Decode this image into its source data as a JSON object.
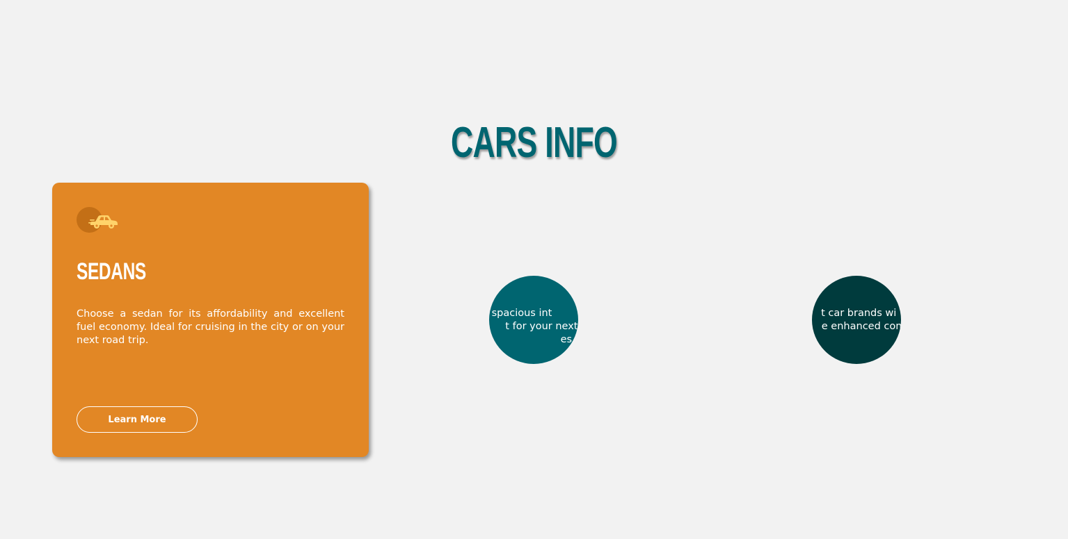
{
  "page": {
    "title": "CARS INFO"
  },
  "cards": [
    {
      "title": "SEDANS",
      "icon": "car-icon",
      "description": "Choose a sedan for its affordability and excellent fuel economy. Ideal for cruising in the city or on your next road trip.",
      "button_label": "Learn More",
      "color": "#e28725"
    },
    {
      "description_visible": "its spacious int\nt for your next fa\nes.",
      "color": "#006570"
    },
    {
      "description_visible": "t car brands wi\ne enhanced com\nstyle.",
      "color": "#003b3d"
    }
  ],
  "colors": {
    "background": "#f2f2f2",
    "title": "#006570",
    "orange": "#e28725",
    "teal": "#006570",
    "dark_teal": "#003b3d",
    "icon_accent": "#ffd36a"
  }
}
